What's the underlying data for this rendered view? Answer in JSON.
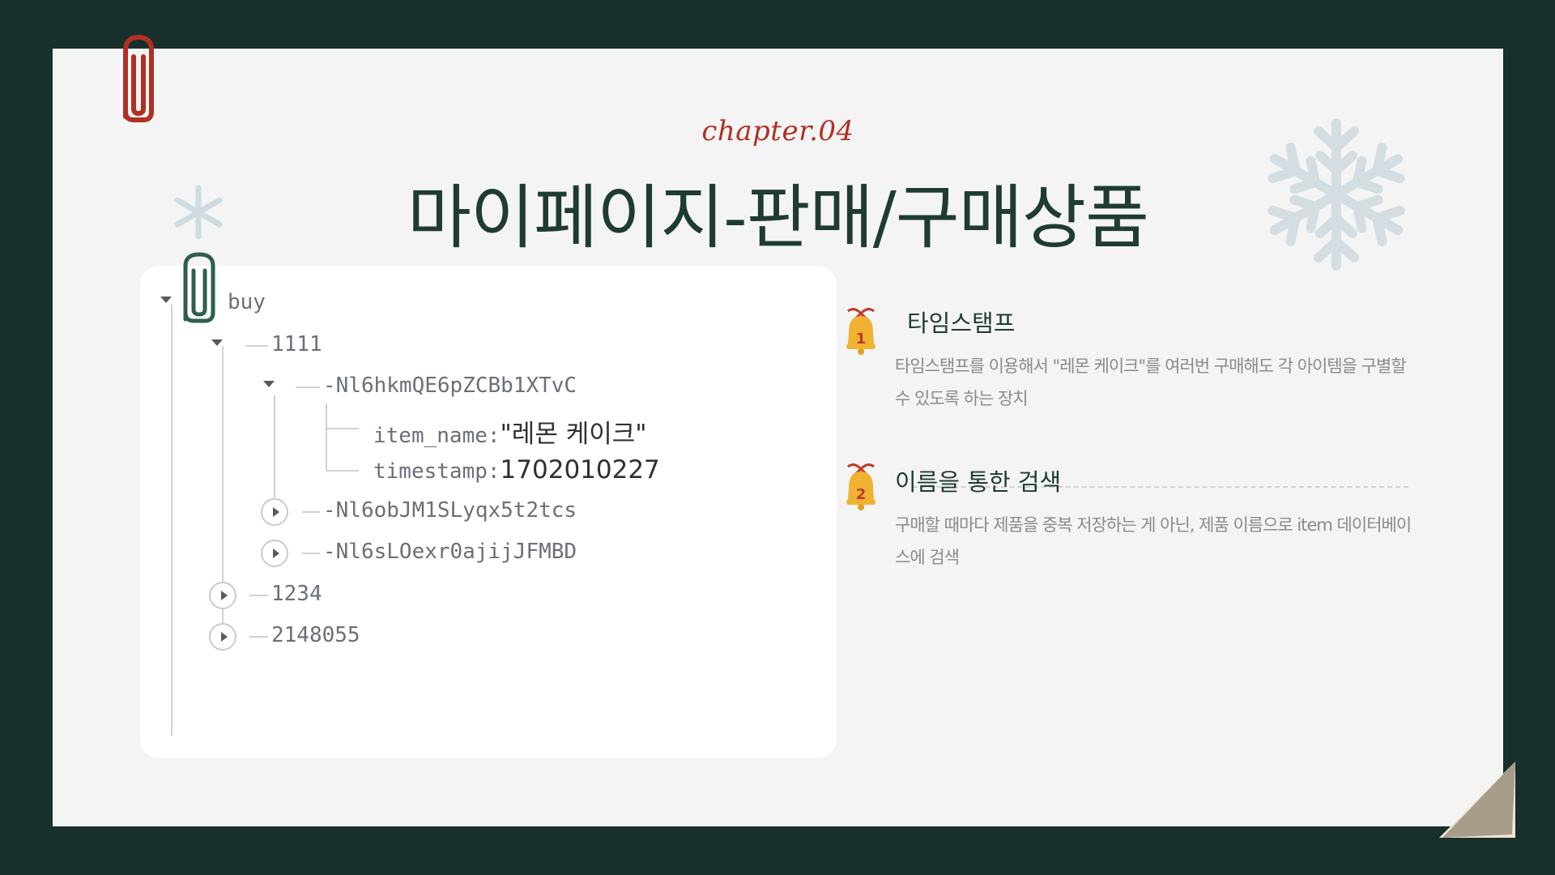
{
  "slide": {
    "chapter": "chapter.04",
    "title": "마이페이지-판매/구매상품"
  },
  "tree": {
    "root_label": "buy",
    "user_1": "1111",
    "item_key_open": "-Nl6hkmQE6pZCBb1XTvC",
    "field_item_name_key": "item_name:",
    "field_item_name_value": "\"레몬 케이크\"",
    "field_timestamp_key": "timestamp:",
    "field_timestamp_value": "1702010227",
    "item_key_2": "-Nl6obJM1SLyqx5t2tcs",
    "item_key_3": "-Nl6sLOexr0ajijJFMBD",
    "user_2": "1234",
    "user_3": "2148055"
  },
  "features": [
    {
      "number": "1",
      "title": "타임스탬프",
      "description": "타임스탬프를 이용해서 \"레몬 케이크\"를 여러번 구매해도 각 아이템을 구별할 수 있도록 하는 장치"
    },
    {
      "number": "2",
      "title": "이름을 통한 검색",
      "description": "구매할 때마다 제품을 중복 저장하는 게 아닌, 제품 이름으로 item 데이터베이스에 검색"
    }
  ],
  "colors": {
    "background": "#17302b",
    "slide": "#f4f4f4",
    "accent_red": "#b03024",
    "title_green": "#1f3b33",
    "bell_gold": "#f0b232"
  },
  "icons": {
    "top_clip": "paperclip-red-icon",
    "card_clip": "paperclip-green-icon",
    "feature_marker": "bell-icon",
    "decor_large": "snowflake-icon",
    "decor_small": "snowflake-small-icon"
  }
}
